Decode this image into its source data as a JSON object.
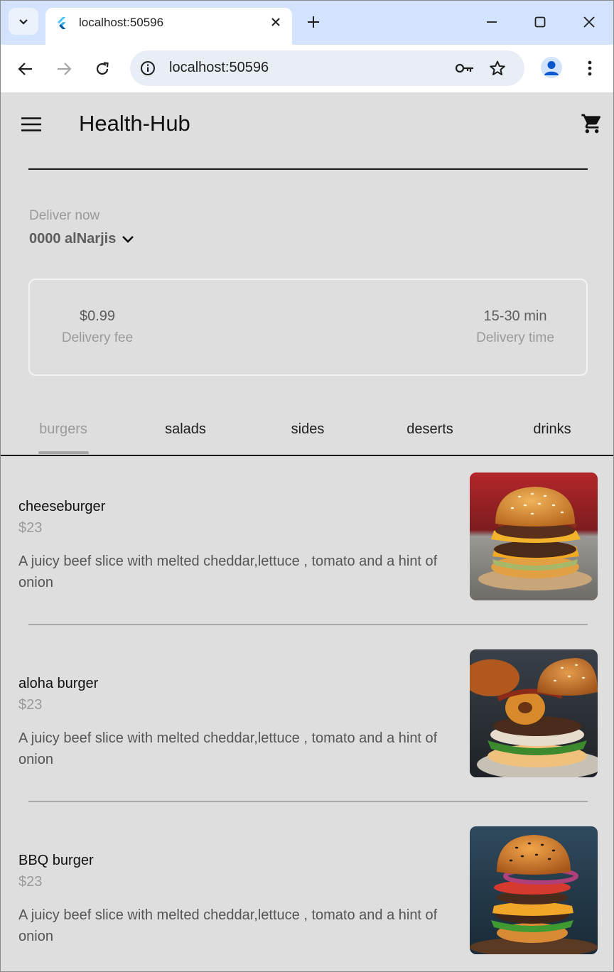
{
  "browser": {
    "tab_title": "localhost:50596",
    "url": "localhost:50596"
  },
  "app": {
    "title": "Health-Hub",
    "deliver_label": "Deliver now",
    "address": "0000 alNarjis",
    "delivery_fee_value": "$0.99",
    "delivery_fee_label": "Delivery fee",
    "delivery_time_value": "15-30 min",
    "delivery_time_label": "Delivery time"
  },
  "categories": [
    "burgers",
    "salads",
    "sides",
    "deserts",
    "drinks"
  ],
  "active_category": "burgers",
  "items": [
    {
      "name": "cheeseburger",
      "price": "$23",
      "description": " A juicy beef slice with melted cheddar,lettuce , tomato and a hint of onion",
      "image": "cheeseburger-photo"
    },
    {
      "name": "aloha burger",
      "price": "$23",
      "description": " A juicy beef slice with melted cheddar,lettuce , tomato and a hint of onion",
      "image": "aloha-burger-photo"
    },
    {
      "name": "BBQ burger",
      "price": "$23",
      "description": " A juicy beef slice with melted cheddar,lettuce , tomato and a hint of onion",
      "image": "bbq-burger-photo"
    }
  ],
  "icons": {
    "tab_search": "chevron-down-icon",
    "favicon": "flutter-icon",
    "tab_close": "close-icon",
    "new_tab": "plus-icon",
    "minimize": "minimize-icon",
    "maximize": "maximize-icon",
    "window_close": "close-icon",
    "back": "arrow-left-icon",
    "forward": "arrow-right-icon",
    "reload": "reload-icon",
    "site_info": "info-icon",
    "password": "key-icon",
    "bookmark": "star-icon",
    "profile": "avatar-icon",
    "browser_menu": "kebab-menu-icon",
    "drawer": "hamburger-menu-icon",
    "cart": "shopping-cart-icon",
    "address_dropdown": "chevron-down-icon"
  },
  "colors": {
    "tabstrip": "#d3e3fd",
    "app_background": "#dedede",
    "text_primary": "#111111",
    "text_muted": "#9a9a9a"
  }
}
